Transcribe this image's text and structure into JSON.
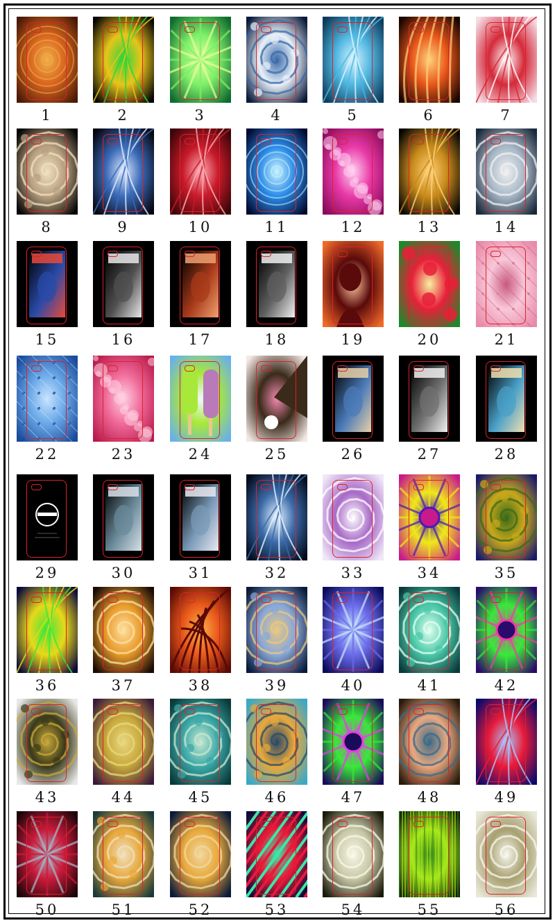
{
  "sheet": {
    "items": [
      {
        "label": "1",
        "colors": [
          "#4a1a06",
          "#d8641e",
          "#f2b04a"
        ],
        "motif": "rings"
      },
      {
        "label": "2",
        "colors": [
          "#050505",
          "#e8c41a",
          "#2ad63c"
        ],
        "motif": "neon"
      },
      {
        "label": "3",
        "colors": [
          "#0f6a2e",
          "#7ef06a",
          "#e8ff9a"
        ],
        "motif": "burst"
      },
      {
        "label": "4",
        "colors": [
          "#0a1a3a",
          "#e8f0f8",
          "#3a6aa8"
        ],
        "motif": "fractal"
      },
      {
        "label": "5",
        "colors": [
          "#0d3a5a",
          "#4fb6e0",
          "#d8f4ff"
        ],
        "motif": "swirl"
      },
      {
        "label": "6",
        "colors": [
          "#1a0500",
          "#e8561a",
          "#ffd27a"
        ],
        "motif": "flame"
      },
      {
        "label": "7",
        "colors": [
          "#f4dce4",
          "#d42a3a",
          "#ffffff"
        ],
        "motif": "swirl"
      },
      {
        "label": "8",
        "colors": [
          "#050505",
          "#b8a080",
          "#f0e0c0"
        ],
        "motif": "fractal"
      },
      {
        "label": "9",
        "colors": [
          "#050510",
          "#3a6ab8",
          "#e0ecff"
        ],
        "motif": "swirl"
      },
      {
        "label": "10",
        "colors": [
          "#3a0508",
          "#c81a2a",
          "#ffb0b8"
        ],
        "motif": "neon"
      },
      {
        "label": "11",
        "colors": [
          "#020a30",
          "#2a8ae8",
          "#c8f4ff"
        ],
        "motif": "rings"
      },
      {
        "label": "12",
        "colors": [
          "#8a0a5a",
          "#e83aa8",
          "#ffd0f0"
        ],
        "motif": "dots"
      },
      {
        "label": "13",
        "colors": [
          "#050505",
          "#c88a1a",
          "#ffd27a"
        ],
        "motif": "neon"
      },
      {
        "label": "14",
        "colors": [
          "#1a2a3a",
          "#a8b8c8",
          "#f0f0f0"
        ],
        "motif": "spiral"
      },
      {
        "label": "15",
        "colors": [
          "#000000",
          "#2a4aa8",
          "#e84a3a"
        ],
        "motif": "poster"
      },
      {
        "label": "16",
        "colors": [
          "#000000",
          "#505050",
          "#e8e8e8"
        ],
        "motif": "poster"
      },
      {
        "label": "17",
        "colors": [
          "#000000",
          "#a83a1a",
          "#f0a070"
        ],
        "motif": "poster"
      },
      {
        "label": "18",
        "colors": [
          "#000000",
          "#606060",
          "#f0f0f0"
        ],
        "motif": "poster"
      },
      {
        "label": "19",
        "colors": [
          "#f06a2a",
          "#5a0a0a",
          "#ffc8a0"
        ],
        "motif": "silhouette"
      },
      {
        "label": "20",
        "colors": [
          "#1a8a2a",
          "#e8203a",
          "#f8f0a0"
        ],
        "motif": "flowers"
      },
      {
        "label": "21",
        "colors": [
          "#e88aa8",
          "#f8c8d8",
          "#c85a80"
        ],
        "motif": "quilt"
      },
      {
        "label": "22",
        "colors": [
          "#1a4a9a",
          "#6aa8e8",
          "#c8e4ff"
        ],
        "motif": "quilt"
      },
      {
        "label": "23",
        "colors": [
          "#b81a4a",
          "#f06a9a",
          "#ffd0e0"
        ],
        "motif": "dots"
      },
      {
        "label": "24",
        "colors": [
          "#6ab0e8",
          "#a8e83a",
          "#f0f8ff"
        ],
        "motif": "popsicle"
      },
      {
        "label": "25",
        "colors": [
          "#f4e8e4",
          "#3a2a1a",
          "#f08ab0"
        ],
        "motif": "dog"
      },
      {
        "label": "26",
        "colors": [
          "#000000",
          "#4a7ab8",
          "#e8d0a8"
        ],
        "motif": "poster"
      },
      {
        "label": "27",
        "colors": [
          "#000000",
          "#707070",
          "#f0f0f0"
        ],
        "motif": "poster"
      },
      {
        "label": "28",
        "colors": [
          "#000000",
          "#4aa0c8",
          "#f0e0b0"
        ],
        "motif": "poster"
      },
      {
        "label": "29",
        "colors": [
          "#000000",
          "#2a2a2a",
          "#ffffff"
        ],
        "motif": "logo"
      },
      {
        "label": "30",
        "colors": [
          "#000000",
          "#6a8a9a",
          "#d8e0e8"
        ],
        "motif": "poster"
      },
      {
        "label": "31",
        "colors": [
          "#000000",
          "#7a9ab8",
          "#e8e8f0"
        ],
        "motif": "poster"
      },
      {
        "label": "32",
        "colors": [
          "#020a1a",
          "#3a6aa8",
          "#e8f4ff"
        ],
        "motif": "neon"
      },
      {
        "label": "33",
        "colors": [
          "#f0e8f8",
          "#a86ac8",
          "#ffffff"
        ],
        "motif": "spiral"
      },
      {
        "label": "34",
        "colors": [
          "#c81a8a",
          "#f0e81a",
          "#4a1ab8"
        ],
        "motif": "mandala"
      },
      {
        "label": "35",
        "colors": [
          "#1a1a6a",
          "#c8a81a",
          "#3a6a1a"
        ],
        "motif": "fractal"
      },
      {
        "label": "36",
        "colors": [
          "#0a0a3a",
          "#e8d81a",
          "#3ae83a"
        ],
        "motif": "neon"
      },
      {
        "label": "37",
        "colors": [
          "#1a0a05",
          "#e89a2a",
          "#ffe0a0"
        ],
        "motif": "spiral"
      },
      {
        "label": "38",
        "colors": [
          "#5a0a05",
          "#e85a1a",
          "#ffb04a"
        ],
        "motif": "branches"
      },
      {
        "label": "39",
        "colors": [
          "#0a1a3a",
          "#8aa8d8",
          "#e8c880"
        ],
        "motif": "fractal"
      },
      {
        "label": "40",
        "colors": [
          "#0a0a5a",
          "#6a6ae8",
          "#c8e4ff"
        ],
        "motif": "burst"
      },
      {
        "label": "41",
        "colors": [
          "#0a3a3a",
          "#4ac8a8",
          "#e0fff0"
        ],
        "motif": "fractal"
      },
      {
        "label": "42",
        "colors": [
          "#2a0a6a",
          "#3ae83a",
          "#f03aa8"
        ],
        "motif": "mandala"
      },
      {
        "label": "43",
        "colors": [
          "#e8e8e8",
          "#3a3a1a",
          "#c8a83a"
        ],
        "motif": "fractal"
      },
      {
        "label": "44",
        "colors": [
          "#3a1a3a",
          "#c8a83a",
          "#e8d880"
        ],
        "motif": "spiral"
      },
      {
        "label": "45",
        "colors": [
          "#0a3a3a",
          "#3aa8a8",
          "#c8e8d0"
        ],
        "motif": "fractal"
      },
      {
        "label": "46",
        "colors": [
          "#3aa8c8",
          "#e8a83a",
          "#2a4a6a"
        ],
        "motif": "fractal"
      },
      {
        "label": "47",
        "colors": [
          "#1a0a5a",
          "#3ae83a",
          "#e83ae8"
        ],
        "motif": "mandala"
      },
      {
        "label": "48",
        "colors": [
          "#2a1a0a",
          "#e8a880",
          "#3a6a8a"
        ],
        "motif": "spiral"
      },
      {
        "label": "49",
        "colors": [
          "#0a0a6a",
          "#e81a3a",
          "#a8c8ff"
        ],
        "motif": "swirl"
      },
      {
        "label": "50",
        "colors": [
          "#1a0508",
          "#c81a3a",
          "#a8b8c8"
        ],
        "motif": "burst"
      },
      {
        "label": "51",
        "colors": [
          "#1a3a3a",
          "#e8a83a",
          "#f0e0c0"
        ],
        "motif": "fractal"
      },
      {
        "label": "52",
        "colors": [
          "#0a1a3a",
          "#e8a83a",
          "#f0d8a0"
        ],
        "motif": "spiral"
      },
      {
        "label": "53",
        "colors": [
          "#0a0a3a",
          "#e81a3a",
          "#3ae8a8"
        ],
        "motif": "stripes"
      },
      {
        "label": "54",
        "colors": [
          "#1a1a0a",
          "#c8c8a8",
          "#f8f8e8"
        ],
        "motif": "spiral"
      },
      {
        "label": "55",
        "colors": [
          "#0a1a05",
          "#a8e81a",
          "#3a8a1a"
        ],
        "motif": "streaks"
      },
      {
        "label": "56",
        "colors": [
          "#e8e8d8",
          "#a8a070",
          "#f8f8f0"
        ],
        "motif": "spiral"
      }
    ]
  }
}
